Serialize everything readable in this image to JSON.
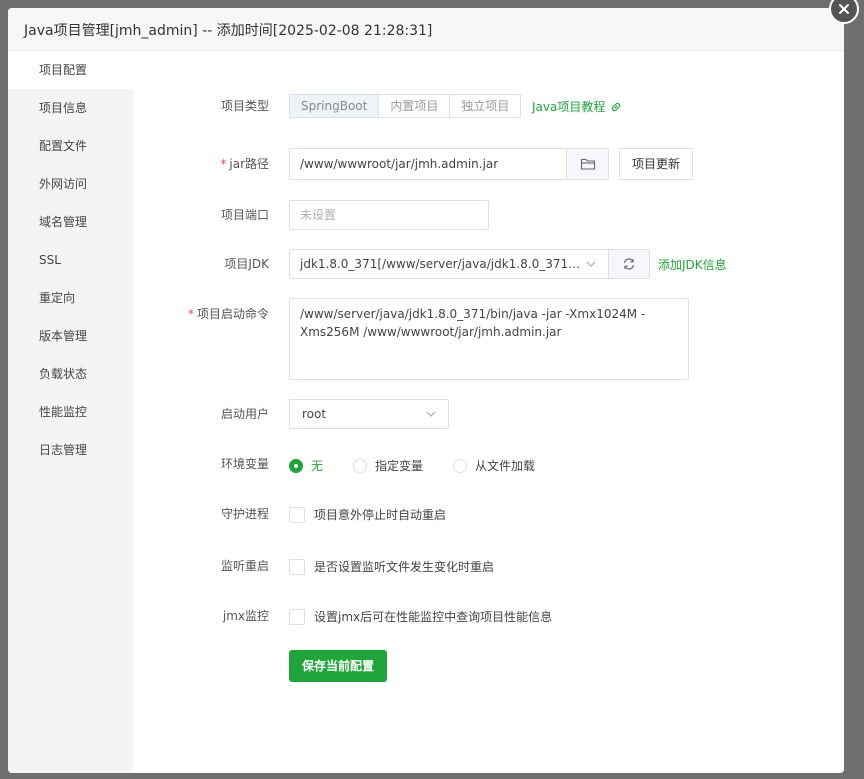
{
  "dialog": {
    "title": "Java项目管理[jmh_admin] -- 添加时间[2025-02-08 21:28:31]"
  },
  "sidebar": {
    "items": [
      {
        "label": "项目配置",
        "active": true
      },
      {
        "label": "项目信息"
      },
      {
        "label": "配置文件"
      },
      {
        "label": "外网访问"
      },
      {
        "label": "域名管理"
      },
      {
        "label": "SSL"
      },
      {
        "label": "重定向"
      },
      {
        "label": "版本管理"
      },
      {
        "label": "负载状态"
      },
      {
        "label": "性能监控"
      },
      {
        "label": "日志管理"
      }
    ]
  },
  "form": {
    "project_type": {
      "label": "项目类型",
      "options": [
        "SpringBoot",
        "内置项目",
        "独立项目"
      ],
      "selected": "SpringBoot",
      "tutorial_link": "Java项目教程"
    },
    "jar_path": {
      "required_mark": "*",
      "label": "jar路径",
      "value": "/www/wwwroot/jar/jmh.admin.jar",
      "update_button": "项目更新"
    },
    "port": {
      "label": "项目端口",
      "placeholder": "未设置"
    },
    "jdk": {
      "label": "项目JDK",
      "value": "jdk1.8.0_371[/www/server/java/jdk1.8.0_371/bi...",
      "add_link": "添加JDK信息"
    },
    "start_command": {
      "required_mark": "*",
      "label": "项目启动命令",
      "value": "/www/server/java/jdk1.8.0_371/bin/java -jar  -Xmx1024M -Xms256M /www/wwwroot/jar/jmh.admin.jar"
    },
    "start_user": {
      "label": "启动用户",
      "value": "root"
    },
    "env": {
      "label": "环境变量",
      "options": [
        "无",
        "指定变量",
        "从文件加载"
      ],
      "selected": "无"
    },
    "daemon": {
      "label": "守护进程",
      "checkbox_label": "项目意外停止时自动重启",
      "checked": false
    },
    "watch_restart": {
      "label": "监听重启",
      "checkbox_label": "是否设置监听文件发生变化时重启",
      "checked": false
    },
    "jmx": {
      "label": "jmx监控",
      "checkbox_label": "设置jmx后可在性能监控中查询项目性能信息",
      "checked": false
    },
    "save_button": "保存当前配置"
  },
  "colors": {
    "accent": "#20a53a",
    "required": "#e05050"
  },
  "icons": [
    "close-icon",
    "folder-icon",
    "refresh-icon",
    "chevron-down-icon",
    "link-icon"
  ]
}
